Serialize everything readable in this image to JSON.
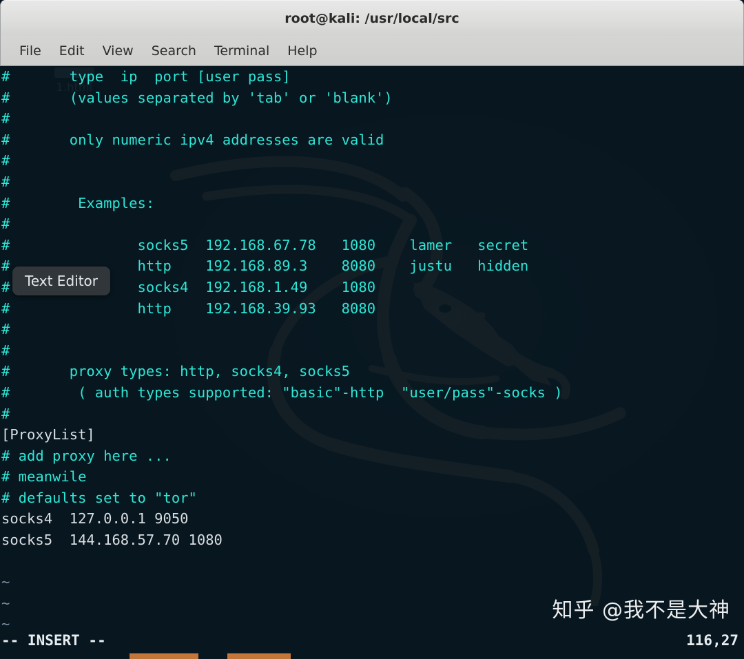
{
  "window": {
    "title": "root@kali: /usr/local/src",
    "menu": [
      "File",
      "Edit",
      "View",
      "Search",
      "Terminal",
      "Help"
    ]
  },
  "desktop": {
    "icon_label": "1.html"
  },
  "tooltip": {
    "text": "Text Editor"
  },
  "watermark": {
    "text": "知乎 @我不是大神"
  },
  "editor": {
    "lines": [
      {
        "text": "#       type  ip  port [user pass]",
        "style": "cyan"
      },
      {
        "text": "#       (values separated by 'tab' or 'blank')",
        "style": "cyan"
      },
      {
        "text": "#",
        "style": "cyan"
      },
      {
        "text": "#       only numeric ipv4 addresses are valid",
        "style": "cyan"
      },
      {
        "text": "#",
        "style": "cyan"
      },
      {
        "text": "#",
        "style": "cyan"
      },
      {
        "text": "#        Examples:",
        "style": "cyan"
      },
      {
        "text": "#",
        "style": "cyan"
      },
      {
        "text": "#               socks5  192.168.67.78   1080    lamer   secret",
        "style": "cyan"
      },
      {
        "text": "#               http    192.168.89.3    8080    justu   hidden",
        "style": "cyan"
      },
      {
        "text": "#               socks4  192.168.1.49    1080",
        "style": "cyan"
      },
      {
        "text": "#               http    192.168.39.93   8080",
        "style": "cyan"
      },
      {
        "text": "#",
        "style": "cyan"
      },
      {
        "text": "#",
        "style": "cyan"
      },
      {
        "text": "#       proxy types: http, socks4, socks5",
        "style": "cyan"
      },
      {
        "text": "#        ( auth types supported: \"basic\"-http  \"user/pass\"-socks )",
        "style": "cyan"
      },
      {
        "text": "#",
        "style": "cyan"
      },
      {
        "text": "[ProxyList]",
        "style": "white"
      },
      {
        "text": "# add proxy here ...",
        "style": "cyan"
      },
      {
        "text": "# meanwile",
        "style": "cyan"
      },
      {
        "text": "# defaults set to \"tor\"",
        "style": "cyan"
      },
      {
        "text": "socks4  127.0.0.1 9050",
        "style": "white"
      },
      {
        "text": "socks5  144.168.57.70 1080",
        "style": "white"
      },
      {
        "text": "",
        "style": "cyan"
      },
      {
        "text": "~",
        "style": "tilde"
      },
      {
        "text": "~",
        "style": "tilde"
      },
      {
        "text": "~",
        "style": "tilde"
      }
    ],
    "status_mode": "-- INSERT --",
    "status_ruler": "116,27"
  },
  "colors": {
    "terminal_text": "#2ee6d6",
    "terminal_text_white": "#d9dee1",
    "titlebar": "#dededd",
    "taskbar_indicator": "#c2763a"
  }
}
